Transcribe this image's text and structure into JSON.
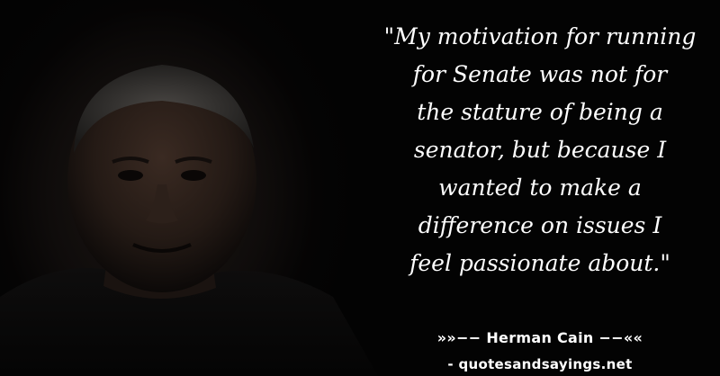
{
  "photo": {
    "subject_icon": "portrait-photo"
  },
  "quote": {
    "text": "\"My motivation for running\nfor Senate was not for\nthe stature of being a\nsenator, but because I\nwanted to make a\ndifference on issues I\nfeel passionate about.\""
  },
  "attribution": {
    "author_line": "»»−− Herman Cain −−««",
    "site_line": "- quotesandsayings.net"
  },
  "colors": {
    "background": "#030303",
    "text": "#ffffff"
  }
}
